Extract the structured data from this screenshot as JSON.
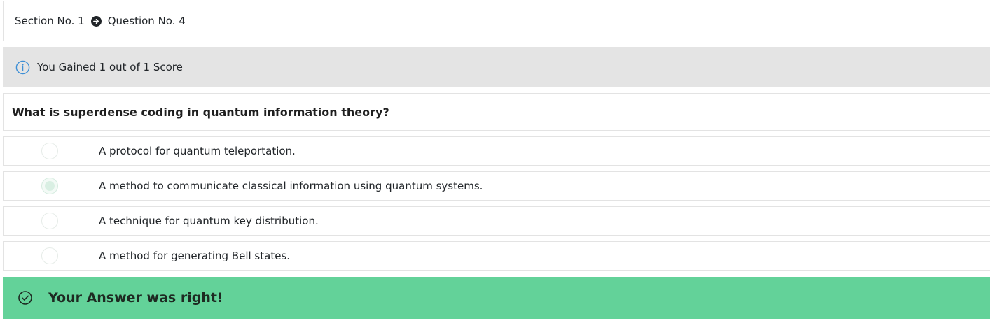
{
  "breadcrumb": {
    "section": "Section No. 1",
    "question": "Question No. 4"
  },
  "score": {
    "text": "You Gained 1 out of 1 Score",
    "icon": "info-circle-icon"
  },
  "question": {
    "text": "What is superdense coding in quantum information theory?"
  },
  "options": [
    {
      "label": "A protocol for quantum teleportation.",
      "selected": false
    },
    {
      "label": "A method to communicate classical information using quantum systems.",
      "selected": true
    },
    {
      "label": "A technique for quantum key distribution.",
      "selected": false
    },
    {
      "label": "A method for generating Bell states.",
      "selected": false
    }
  ],
  "result": {
    "text": "Your Answer was right!",
    "icon": "check-circle-icon",
    "color": "#63d299"
  }
}
